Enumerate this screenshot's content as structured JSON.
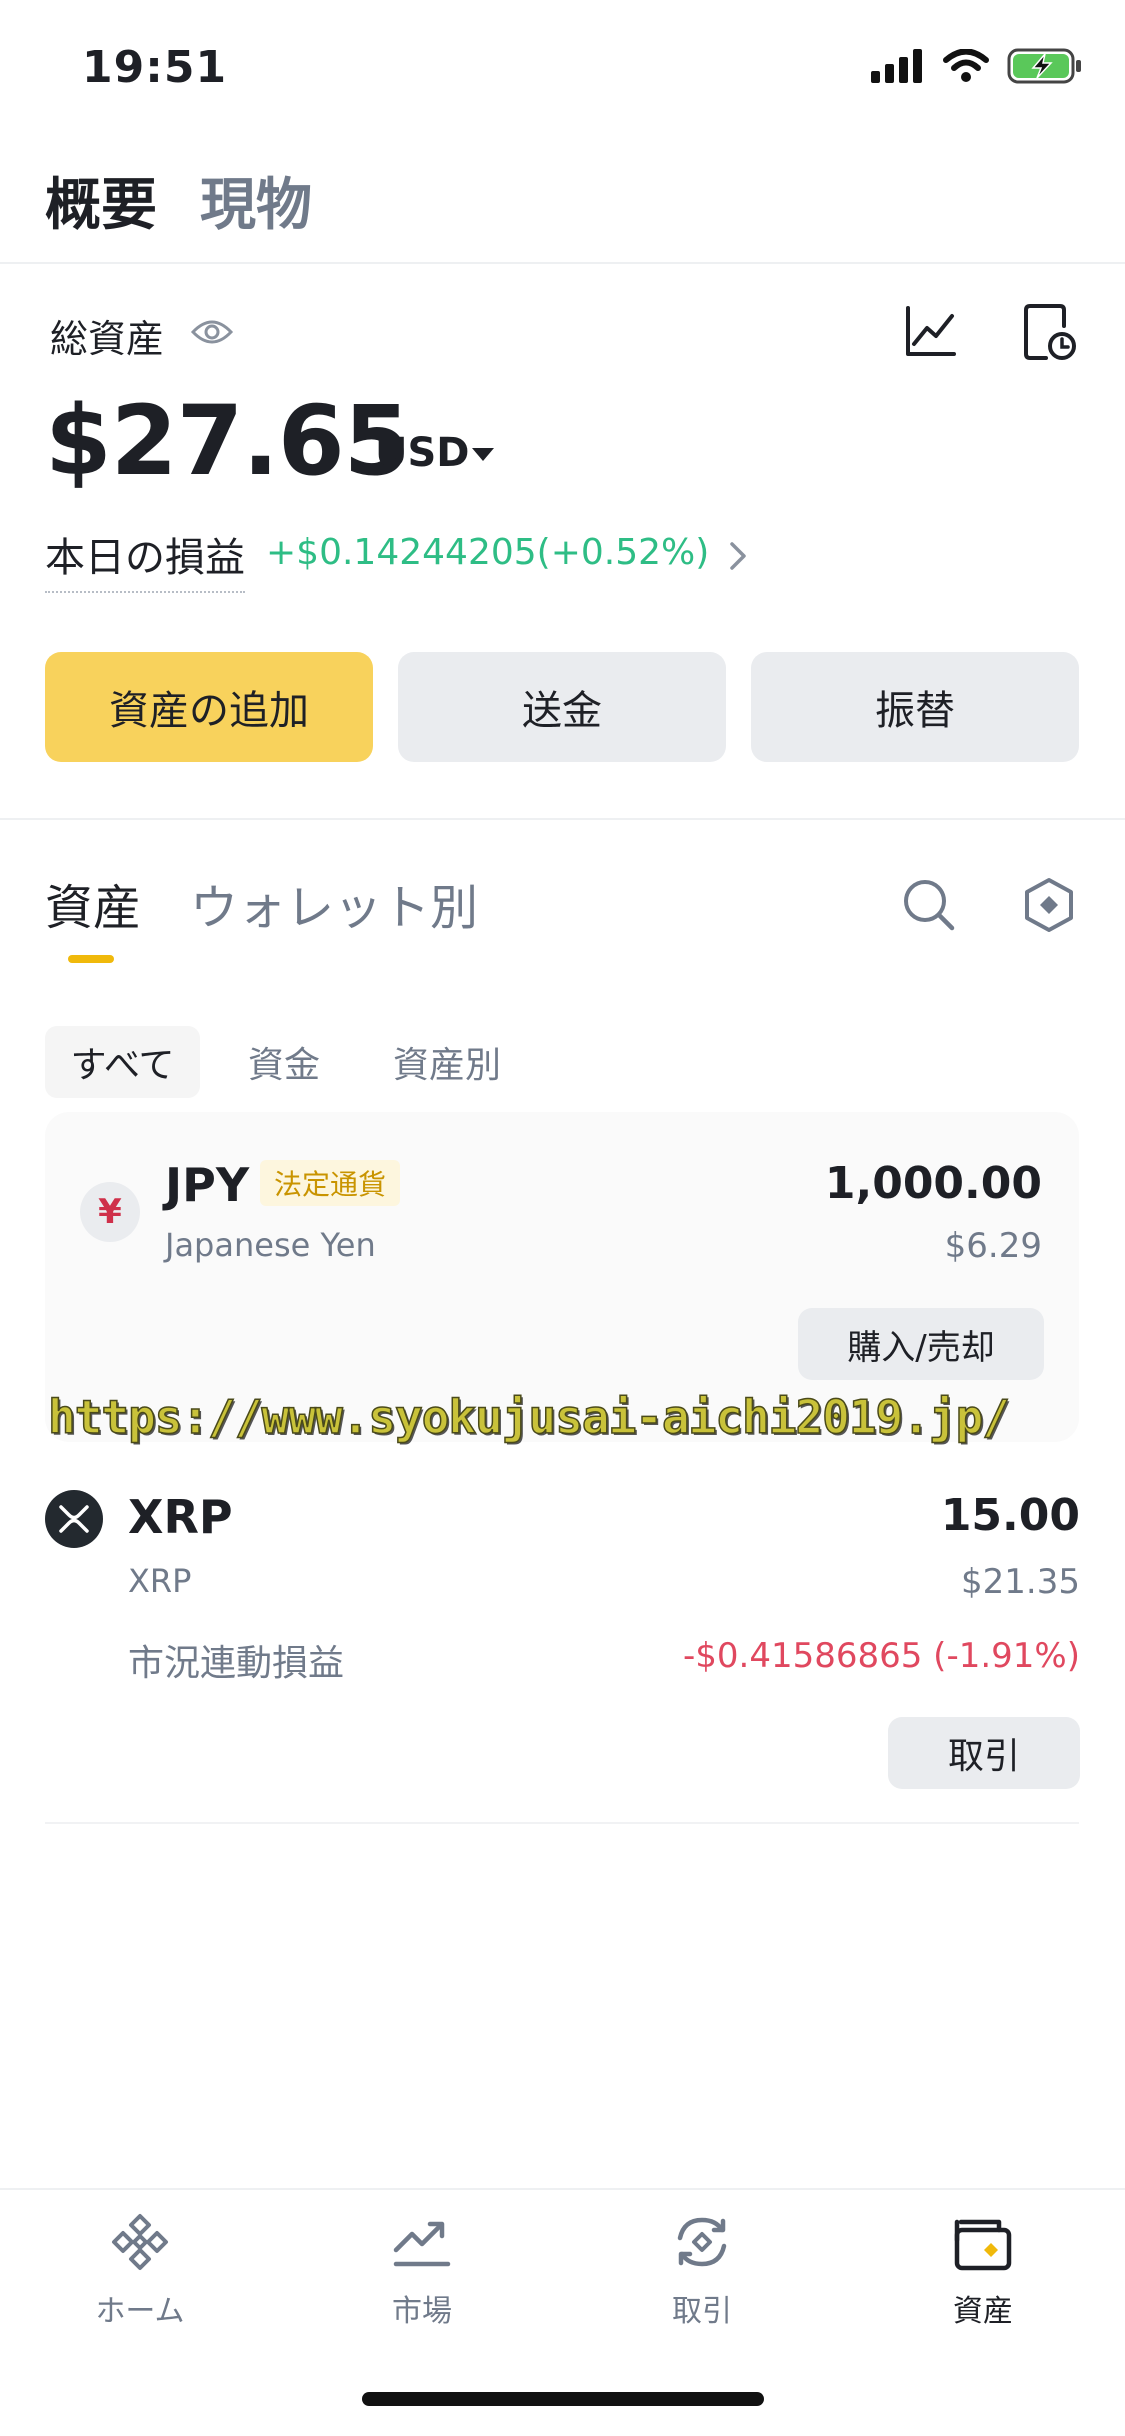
{
  "status_bar": {
    "time": "19:51"
  },
  "top_tabs": [
    {
      "label": "概要",
      "active": true
    },
    {
      "label": "現物",
      "active": false
    }
  ],
  "total_assets": {
    "label": "総資産",
    "amount": "$27.65",
    "currency": "USD",
    "pnl_label": "本日の損益",
    "pnl_value": "+$0.14244205(+0.52%)"
  },
  "actions": {
    "add_asset": "資産の追加",
    "send": "送金",
    "transfer": "振替"
  },
  "asset_tabs": [
    {
      "label": "資産",
      "active": true
    },
    {
      "label": "ウォレット別",
      "active": false
    }
  ],
  "filters": [
    {
      "label": "すべて",
      "active": true
    },
    {
      "label": "資金",
      "active": false
    },
    {
      "label": "資産別",
      "active": false
    }
  ],
  "assets": {
    "jpy": {
      "icon_glyph": "¥",
      "symbol": "JPY",
      "badge": "法定通貨",
      "name": "Japanese Yen",
      "amount": "1,000.00",
      "usd_value": "$6.29",
      "action": "購入/売却"
    },
    "xrp": {
      "symbol": "XRP",
      "name": "XRP",
      "amount": "15.00",
      "usd_value": "$21.35",
      "pnl_label": "市況連動損益",
      "pnl_value": "-$0.41586865 (-1.91%)",
      "action": "取引"
    }
  },
  "watermark": "https://www.syokujusai-aichi2019.jp/",
  "bottom_nav": [
    {
      "label": "ホーム",
      "icon": "binance-logo-icon",
      "active": false
    },
    {
      "label": "市場",
      "icon": "market-trend-icon",
      "active": false
    },
    {
      "label": "取引",
      "icon": "trade-exchange-icon",
      "active": false
    },
    {
      "label": "資産",
      "icon": "wallet-icon",
      "active": true
    }
  ],
  "colors": {
    "accent_yellow": "#F8D25C",
    "brand_gold": "#F0B90B",
    "positive": "#2EBD85",
    "negative": "#E0485F",
    "muted_text": "#707A8A"
  }
}
